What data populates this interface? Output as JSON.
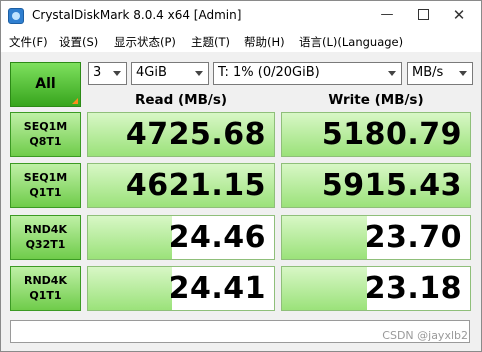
{
  "window": {
    "title": "CrystalDiskMark 8.0.4 x64 [Admin]",
    "minimize": "—",
    "close": "✕"
  },
  "menu": [
    "文件(F)",
    "设置(S)",
    "显示状态(P)",
    "主题(T)",
    "帮助(H)",
    "语言(L)(Language)"
  ],
  "controls": {
    "all_label": "All",
    "count": "3",
    "size": "4GiB",
    "drive": "T: 1% (0/20GiB)",
    "unit": "MB/s"
  },
  "headers": {
    "read": "Read (MB/s)",
    "write": "Write (MB/s)"
  },
  "tests": [
    {
      "line1": "SEQ1M",
      "line2": "Q8T1",
      "read": "4725.68",
      "write": "5180.79",
      "read_fill": 1.0,
      "write_fill": 1.0
    },
    {
      "line1": "SEQ1M",
      "line2": "Q1T1",
      "read": "4621.15",
      "write": "5915.43",
      "read_fill": 1.0,
      "write_fill": 1.0
    },
    {
      "line1": "RND4K",
      "line2": "Q32T1",
      "read": "24.46",
      "write": "23.70",
      "read_fill": 0.45,
      "write_fill": 0.45
    },
    {
      "line1": "RND4K",
      "line2": "Q1T1",
      "read": "24.41",
      "write": "23.18",
      "read_fill": 0.45,
      "write_fill": 0.45
    }
  ],
  "comment": "",
  "watermark": "CSDN @jayxlb2"
}
